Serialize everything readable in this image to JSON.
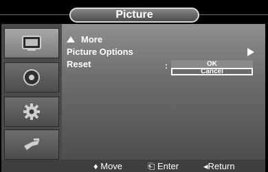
{
  "title": "Picture",
  "sidebar": {
    "items": [
      {
        "icon": "picture-icon",
        "active": true
      },
      {
        "icon": "sound-icon",
        "active": false
      },
      {
        "icon": "setup-gear-icon",
        "active": false
      },
      {
        "icon": "input-plug-icon",
        "active": false
      }
    ]
  },
  "menu": {
    "more_label": "More",
    "picture_options_label": "Picture Options",
    "reset_label": "Reset",
    "reset_separator": ":",
    "reset_options": [
      "OK",
      "Cancel"
    ],
    "reset_selected": "Cancel"
  },
  "help_bar": {
    "move": "♦ Move",
    "enter": "⎗ Enter",
    "return": "◂Return"
  },
  "colors": {
    "panel_top": "#8f8f8f",
    "panel_bottom": "#4e4e4e",
    "text": "#ffffff",
    "background": "#000000"
  }
}
